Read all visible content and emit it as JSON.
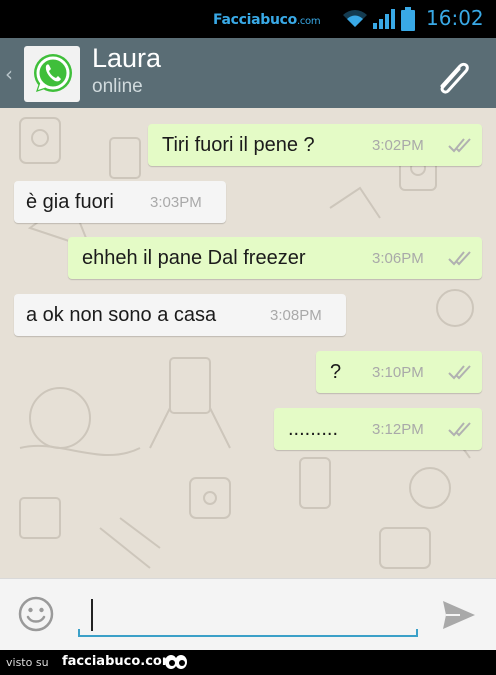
{
  "status_bar": {
    "watermark_brand": "Facciabuco",
    "watermark_suffix": ".com",
    "time": "16:02",
    "icons": [
      "wifi-icon",
      "signal-icon",
      "battery-icon"
    ],
    "accent_color": "#39a9e6"
  },
  "header": {
    "back_glyph": "‹",
    "contact_name": "Laura",
    "contact_status": "online",
    "avatar_icon": "whatsapp-logo",
    "action_icon": "paperclip-icon",
    "background_color": "#5a6d75"
  },
  "chat": {
    "wallpaper": "cartoon-doodle-pattern",
    "background_color": "#e6e0d6",
    "messages": [
      {
        "direction": "outgoing",
        "text": "Tiri fuori il pene ?",
        "time": "3:02PM",
        "ticks": "double-check-icon"
      },
      {
        "direction": "incoming",
        "text": "è gia fuori",
        "time": "3:03PM"
      },
      {
        "direction": "outgoing",
        "text": "ehheh il pane Dal freezer",
        "time": "3:06PM",
        "ticks": "double-check-icon"
      },
      {
        "direction": "incoming",
        "text": "a ok non sono a casa",
        "time": "3:08PM"
      },
      {
        "direction": "outgoing",
        "text": "?",
        "time": "3:10PM",
        "ticks": "double-check-icon"
      },
      {
        "direction": "outgoing",
        "text": ".........",
        "time": "3:12PM",
        "ticks": "double-check-icon"
      }
    ],
    "outgoing_color": "#e4fbc6",
    "incoming_color": "#f5f5f5"
  },
  "input_bar": {
    "emoji_icon": "smiley-icon",
    "message_value": "",
    "send_icon": "send-icon",
    "underline_color": "#3ba0c8"
  },
  "footer": {
    "visto_text": "visto su",
    "brand_text": "facciabuco.com",
    "logo_icon": "eyes-logo"
  }
}
